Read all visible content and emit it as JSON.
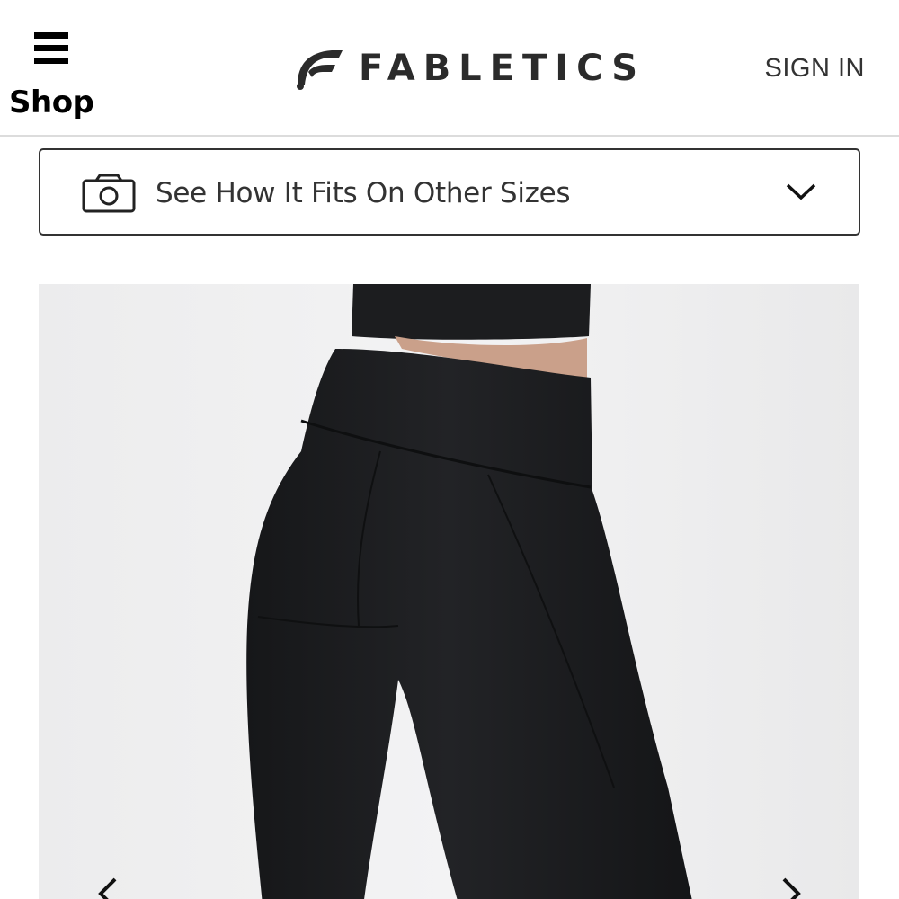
{
  "header": {
    "menu_label": "Shop",
    "brand_name": "FABLETICS",
    "sign_in_label": "SIGN IN"
  },
  "fit_dropdown": {
    "label": "See How It Fits On Other Sizes",
    "icon": "camera-icon",
    "chevron": "chevron-down-icon"
  },
  "product_gallery": {
    "image_subject": "product-photo-black-leggings",
    "prev_icon": "chevron-left-icon",
    "next_icon": "chevron-right-icon"
  },
  "colors": {
    "text_dark": "#2b2b2b",
    "border": "#333333",
    "divider": "#dcdcdc",
    "image_bg": "#eeeeef",
    "garment": "#1b1c1e"
  }
}
